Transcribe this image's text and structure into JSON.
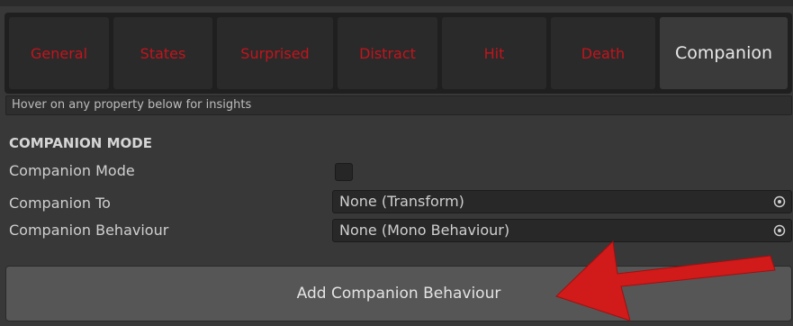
{
  "tabs": [
    {
      "label": "General",
      "active": false
    },
    {
      "label": "States",
      "active": false
    },
    {
      "label": "Surprised",
      "active": false
    },
    {
      "label": "Distract",
      "active": false
    },
    {
      "label": "Hit",
      "active": false
    },
    {
      "label": "Death",
      "active": false
    },
    {
      "label": "Companion",
      "active": true
    }
  ],
  "hint_text": "Hover on any property below for insights",
  "section": {
    "title": "COMPANION MODE",
    "companion_mode_label": "Companion Mode",
    "companion_mode_checked": false,
    "companion_to_label": "Companion To",
    "companion_to_value": "None (Transform)",
    "companion_behaviour_label": "Companion Behaviour",
    "companion_behaviour_value": "None (Mono Behaviour)"
  },
  "add_button_label": "Add Companion Behaviour",
  "colors": {
    "inactive_tab_text": "#c4141c",
    "annotation_arrow": "#d11a1a"
  },
  "icons": {
    "object_picker": "circle-dot-icon",
    "annotation": "red-arrow-icon"
  }
}
